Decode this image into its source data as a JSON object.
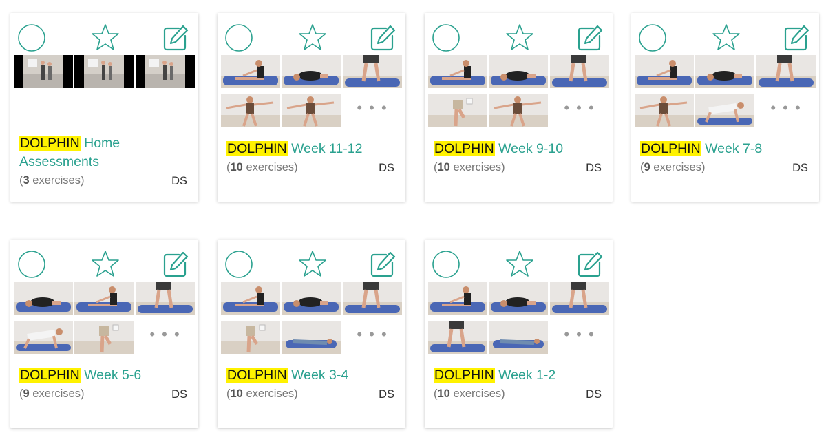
{
  "accent_color": "#2aa18f",
  "highlight_color": "#fff200",
  "icons": {
    "select": "circle-select-icon",
    "favorite": "star-icon",
    "edit": "pencil-edit-icon",
    "more": "ellipsis-icon"
  },
  "more_label": "• • •",
  "cards": [
    {
      "keyword": "DOLPHIN",
      "name": "Home Assessments",
      "count": "3",
      "count_label": "exercises",
      "owner": "DS",
      "thumbs": [
        "room-video",
        "room-video",
        "room-video"
      ],
      "show_more": false
    },
    {
      "keyword": "DOLPHIN",
      "name": "Week 11-12",
      "count": "10",
      "count_label": "exercises",
      "owner": "DS",
      "thumbs": [
        "mat-stretch",
        "mat-fold",
        "standing-legs",
        "standing-arms",
        "standing-arms"
      ],
      "show_more": true
    },
    {
      "keyword": "DOLPHIN",
      "name": "Week 9-10",
      "count": "10",
      "count_label": "exercises",
      "owner": "DS",
      "thumbs": [
        "mat-stretch",
        "mat-fold",
        "standing-legs",
        "standing-single",
        "standing-arms"
      ],
      "show_more": true
    },
    {
      "keyword": "DOLPHIN",
      "name": "Week 7-8",
      "count": "9",
      "count_label": "exercises",
      "owner": "DS",
      "thumbs": [
        "mat-stretch",
        "mat-fold",
        "standing-legs",
        "standing-arms",
        "mat-crawl"
      ],
      "show_more": true
    },
    {
      "keyword": "DOLPHIN",
      "name": "Week 5-6",
      "count": "9",
      "count_label": "exercises",
      "owner": "DS",
      "thumbs": [
        "mat-fold",
        "mat-stretch",
        "standing-legs",
        "mat-crawl",
        "standing-single"
      ],
      "show_more": true
    },
    {
      "keyword": "DOLPHIN",
      "name": "Week 3-4",
      "count": "10",
      "count_label": "exercises",
      "owner": "DS",
      "thumbs": [
        "mat-stretch",
        "mat-fold",
        "standing-legs",
        "standing-single",
        "mat-lying"
      ],
      "show_more": true
    },
    {
      "keyword": "DOLPHIN",
      "name": "Week 1-2",
      "count": "10",
      "count_label": "exercises",
      "owner": "DS",
      "thumbs": [
        "mat-stretch",
        "mat-fold",
        "standing-legs",
        "standing-legs",
        "mat-lying"
      ],
      "show_more": true
    }
  ]
}
